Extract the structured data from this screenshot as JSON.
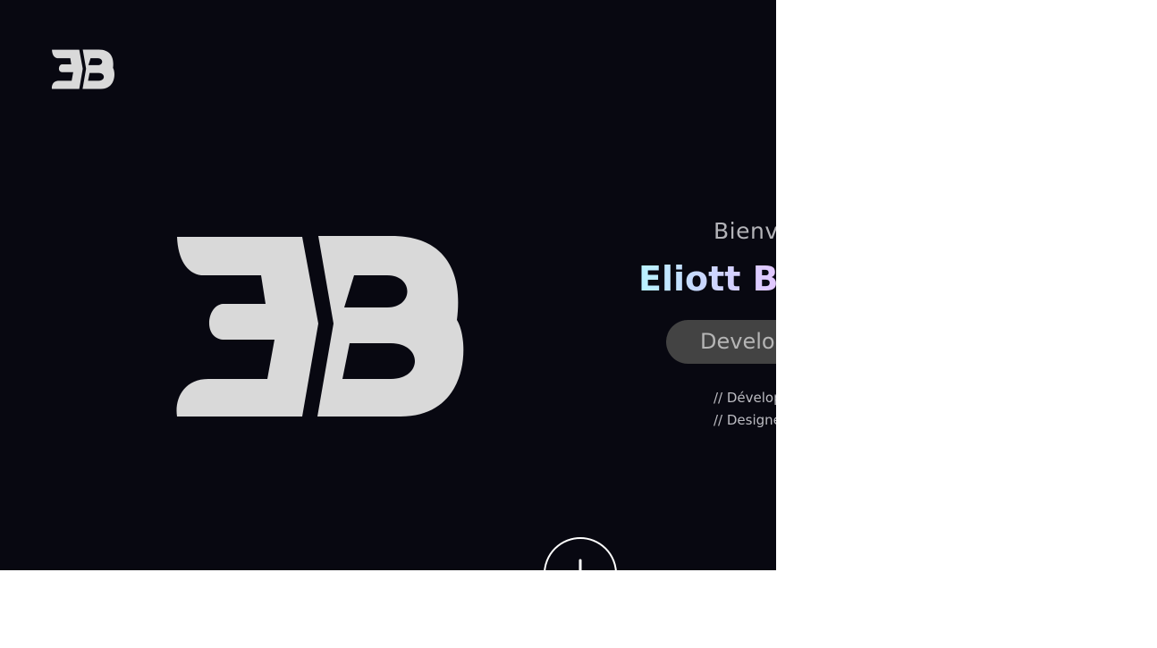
{
  "hero": {
    "logo_small": "EB",
    "logo_big": "EB",
    "welcome": "Bienv",
    "name": "Eliott B",
    "role": "Develo",
    "taglines": [
      "// Dévelop",
      "// Designe"
    ],
    "scroll_icon": "arrow-down-icon"
  },
  "colors": {
    "background": "#080811",
    "logo": "#d9d9d9",
    "pill": "#434343",
    "name_gradient": [
      "#b9f3ff",
      "#c9d7ff",
      "#e3c7ff"
    ]
  }
}
